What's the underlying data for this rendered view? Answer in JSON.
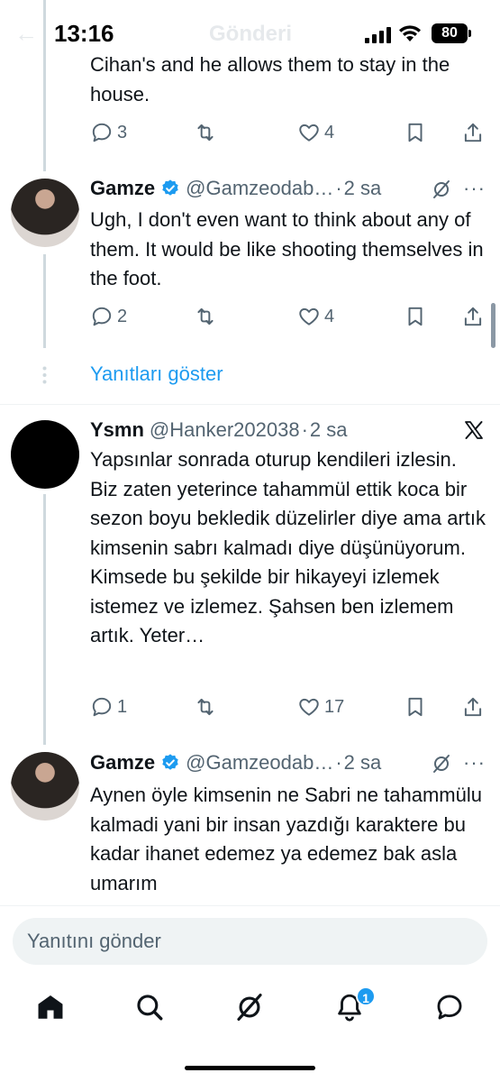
{
  "status": {
    "time": "13:16",
    "battery": "80",
    "ghost_title": "Gönderi"
  },
  "tweets": [
    {
      "text_partial": "Cihan's and he allows them to stay in the house.",
      "replies": "3",
      "likes": "4"
    },
    {
      "name": "Gamze",
      "handle": "@Gamzeodab…",
      "dot": "·",
      "time": "2 sa",
      "text": "Ugh, I don't even want to think about any of them. It would be like shooting themselves in the foot.",
      "replies": "2",
      "likes": "4"
    },
    {
      "name": "Ysmn",
      "handle": "@Hanker202038",
      "dot": "·",
      "time": "2 sa",
      "text": "Yapsınlar sonrada oturup kendileri izlesin. Biz zaten yeterince tahammül ettik koca bir sezon boyu bekledik düzelirler diye ama artık kimsenin sabrı kalmadı diye düşünüyorum. Kimsede bu şekilde bir hikayeyi izlemek istemez ve izlemez. Şahsen ben izlemem artık. Yeter…",
      "replies": "1",
      "likes": "17"
    },
    {
      "name": "Gamze",
      "handle": "@Gamzeodab…",
      "dot": "·",
      "time": "2 sa",
      "text": "Aynen öyle kimsenin ne Sabri ne tahammülu kalmadi yani bir insan yazdığı karaktere bu kadar ihanet edemez ya edemez bak asla umarım"
    }
  ],
  "show_replies": "Yanıtları göster",
  "composer": {
    "placeholder": "Yanıtını gönder"
  },
  "nav": {
    "notification_count": "1"
  },
  "colors": {
    "accent": "#1d9bf0",
    "text": "#0f1419",
    "muted": "#536471"
  }
}
